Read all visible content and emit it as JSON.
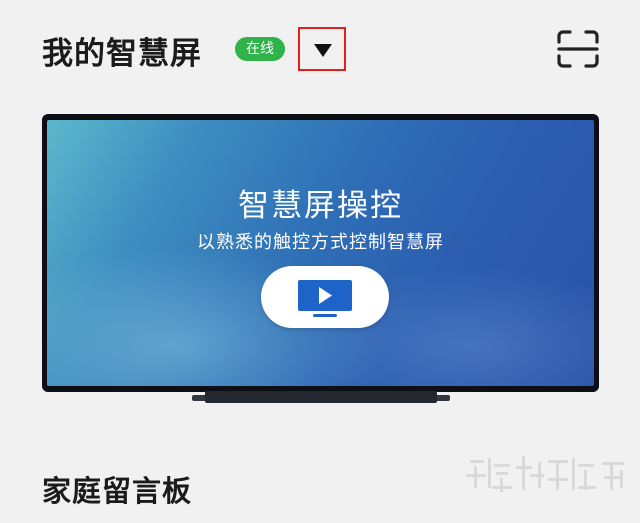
{
  "header": {
    "title": "我的智慧屏",
    "status_badge": "在线",
    "dropdown_icon": "triangle-down-icon",
    "scan_icon": "scan-icon"
  },
  "tv_card": {
    "title": "智慧屏操控",
    "subtitle": "以熟悉的触控方式控制智慧屏",
    "play_icon": "tv-play-icon"
  },
  "section": {
    "title": "家庭留言板"
  },
  "colors": {
    "status_green": "#2fb34a",
    "highlight_red": "#e0201f",
    "screen_blue": "#2c5db0",
    "play_icon_blue": "#1e64c8"
  }
}
